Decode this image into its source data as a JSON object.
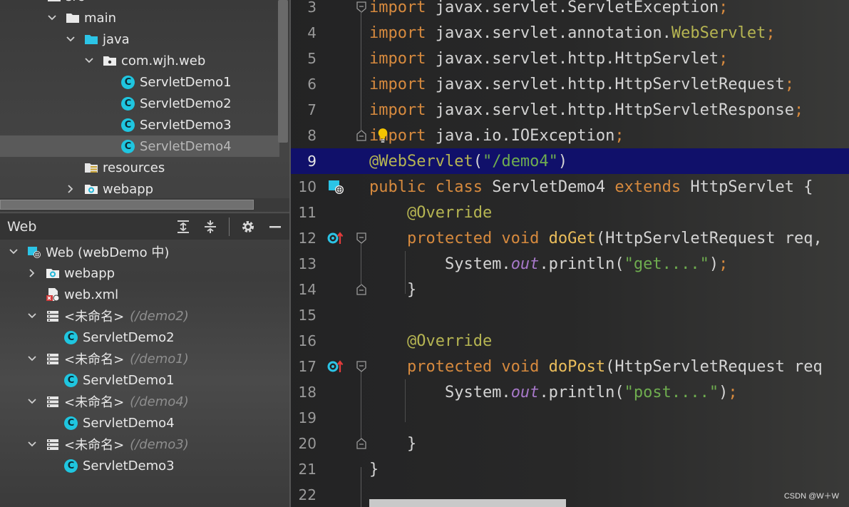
{
  "project_tree": {
    "items": [
      {
        "label": "src",
        "indent": 0,
        "chevron": "down",
        "icon": "folder-icon"
      },
      {
        "label": "main",
        "indent": 1,
        "chevron": "down",
        "icon": "folder-icon"
      },
      {
        "label": "java",
        "indent": 2,
        "chevron": "down",
        "icon": "source-folder-icon"
      },
      {
        "label": "com.wjh.web",
        "indent": 3,
        "chevron": "down",
        "icon": "package-icon"
      },
      {
        "label": "ServletDemo1",
        "indent": 4,
        "chevron": "",
        "icon": "class-icon"
      },
      {
        "label": "ServletDemo2",
        "indent": 4,
        "chevron": "",
        "icon": "class-icon"
      },
      {
        "label": "ServletDemo3",
        "indent": 4,
        "chevron": "",
        "icon": "class-icon"
      },
      {
        "label": "ServletDemo4",
        "indent": 4,
        "chevron": "",
        "icon": "class-icon",
        "selected": true
      },
      {
        "label": "resources",
        "indent": 2,
        "chevron": "",
        "icon": "resources-folder-icon"
      },
      {
        "label": "webapp",
        "indent": 2,
        "chevron": "right",
        "icon": "web-folder-icon"
      }
    ]
  },
  "web_panel": {
    "title": "Web",
    "items": [
      {
        "label": "Web (webDemo 中)",
        "path": "",
        "indent": 0,
        "chevron": "down",
        "icon": "web-facet-icon"
      },
      {
        "label": "webapp",
        "path": "",
        "indent": 1,
        "chevron": "right",
        "icon": "web-folder-icon"
      },
      {
        "label": "web.xml",
        "path": "",
        "indent": 1,
        "chevron": "",
        "icon": "web-xml-icon"
      },
      {
        "label": "<未命名>",
        "path": "(/demo2)",
        "indent": 1,
        "chevron": "down",
        "icon": "servlet-mapping-icon"
      },
      {
        "label": "ServletDemo2",
        "path": "",
        "indent": 2,
        "chevron": "",
        "icon": "class-icon"
      },
      {
        "label": "<未命名>",
        "path": "(/demo1)",
        "indent": 1,
        "chevron": "down",
        "icon": "servlet-mapping-icon"
      },
      {
        "label": "ServletDemo1",
        "path": "",
        "indent": 2,
        "chevron": "",
        "icon": "class-icon"
      },
      {
        "label": "<未命名>",
        "path": "(/demo4)",
        "indent": 1,
        "chevron": "down",
        "icon": "servlet-mapping-icon"
      },
      {
        "label": "ServletDemo4",
        "path": "",
        "indent": 2,
        "chevron": "",
        "icon": "class-icon"
      },
      {
        "label": "<未命名>",
        "path": "(/demo3)",
        "indent": 1,
        "chevron": "down",
        "icon": "servlet-mapping-icon"
      },
      {
        "label": "ServletDemo3",
        "path": "",
        "indent": 2,
        "chevron": "",
        "icon": "class-icon"
      }
    ],
    "class_badge": "C"
  },
  "editor": {
    "current_line": "9",
    "lines": [
      {
        "num": "3",
        "tokens": [
          {
            "t": "import",
            "c": "kw"
          },
          {
            "t": " javax.servlet.ServletException",
            "c": ""
          },
          {
            "t": ";",
            "c": "kw"
          }
        ]
      },
      {
        "num": "4",
        "tokens": [
          {
            "t": "import",
            "c": "kw"
          },
          {
            "t": " javax.servlet.annotation.",
            "c": ""
          },
          {
            "t": "WebServlet",
            "c": "ann"
          },
          {
            "t": ";",
            "c": "kw"
          }
        ]
      },
      {
        "num": "5",
        "tokens": [
          {
            "t": "import",
            "c": "kw"
          },
          {
            "t": " javax.servlet.http.HttpServlet",
            "c": ""
          },
          {
            "t": ";",
            "c": "kw"
          }
        ]
      },
      {
        "num": "6",
        "tokens": [
          {
            "t": "import",
            "c": "kw"
          },
          {
            "t": " javax.servlet.http.HttpServletRequest",
            "c": ""
          },
          {
            "t": ";",
            "c": "kw"
          }
        ]
      },
      {
        "num": "7",
        "tokens": [
          {
            "t": "import",
            "c": "kw"
          },
          {
            "t": " javax.servlet.http.HttpServletResponse",
            "c": ""
          },
          {
            "t": ";",
            "c": "kw"
          }
        ]
      },
      {
        "num": "8",
        "tokens": [
          {
            "t": "import",
            "c": "kw"
          },
          {
            "t": " java.io.IOException",
            "c": ""
          },
          {
            "t": ";",
            "c": "kw"
          }
        ]
      },
      {
        "num": "9",
        "tokens": [
          {
            "t": "@WebServlet",
            "c": "ann"
          },
          {
            "t": "(",
            "c": ""
          },
          {
            "t": "\"/demo4\"",
            "c": "str"
          },
          {
            "t": ")",
            "c": ""
          }
        ]
      },
      {
        "num": "10",
        "tokens": [
          {
            "t": "public class",
            "c": "kw"
          },
          {
            "t": " ServletDemo4 ",
            "c": ""
          },
          {
            "t": "extends",
            "c": "kw"
          },
          {
            "t": " HttpServlet {",
            "c": ""
          }
        ]
      },
      {
        "num": "11",
        "tokens": [
          {
            "t": "    ",
            "c": ""
          },
          {
            "t": "@Override",
            "c": "ann"
          }
        ]
      },
      {
        "num": "12",
        "tokens": [
          {
            "t": "    ",
            "c": ""
          },
          {
            "t": "protected void",
            "c": "kw"
          },
          {
            "t": " ",
            "c": ""
          },
          {
            "t": "doGet",
            "c": "fn"
          },
          {
            "t": "(HttpServletRequest req,",
            "c": ""
          }
        ]
      },
      {
        "num": "13",
        "tokens": [
          {
            "t": "        System.",
            "c": ""
          },
          {
            "t": "out",
            "c": "fld"
          },
          {
            "t": ".println(",
            "c": ""
          },
          {
            "t": "\"get....\"",
            "c": "str"
          },
          {
            "t": ")",
            "c": ""
          },
          {
            "t": ";",
            "c": "kw"
          }
        ]
      },
      {
        "num": "14",
        "tokens": [
          {
            "t": "    }",
            "c": ""
          }
        ]
      },
      {
        "num": "15",
        "tokens": []
      },
      {
        "num": "16",
        "tokens": [
          {
            "t": "    ",
            "c": ""
          },
          {
            "t": "@Override",
            "c": "ann"
          }
        ]
      },
      {
        "num": "17",
        "tokens": [
          {
            "t": "    ",
            "c": ""
          },
          {
            "t": "protected void",
            "c": "kw"
          },
          {
            "t": " ",
            "c": ""
          },
          {
            "t": "doPost",
            "c": "fn"
          },
          {
            "t": "(HttpServletRequest req",
            "c": ""
          }
        ]
      },
      {
        "num": "18",
        "tokens": [
          {
            "t": "        System.",
            "c": ""
          },
          {
            "t": "out",
            "c": "fld"
          },
          {
            "t": ".println(",
            "c": ""
          },
          {
            "t": "\"post....\"",
            "c": "str"
          },
          {
            "t": ")",
            "c": ""
          },
          {
            "t": ";",
            "c": "kw"
          }
        ]
      },
      {
        "num": "19",
        "tokens": []
      },
      {
        "num": "20",
        "tokens": [
          {
            "t": "    }",
            "c": ""
          }
        ]
      },
      {
        "num": "21",
        "tokens": [
          {
            "t": "}",
            "c": ""
          }
        ]
      },
      {
        "num": "22",
        "tokens": []
      }
    ]
  },
  "watermark": "CSDN @W＋W",
  "colors": {
    "keyword": "#d78a3e",
    "annotation": "#b6b552",
    "string": "#6fad4f",
    "field": "#a778c9",
    "method": "#ebbe5b",
    "current_line_bg": "#10106a",
    "class_icon": "#1fc6e0"
  }
}
